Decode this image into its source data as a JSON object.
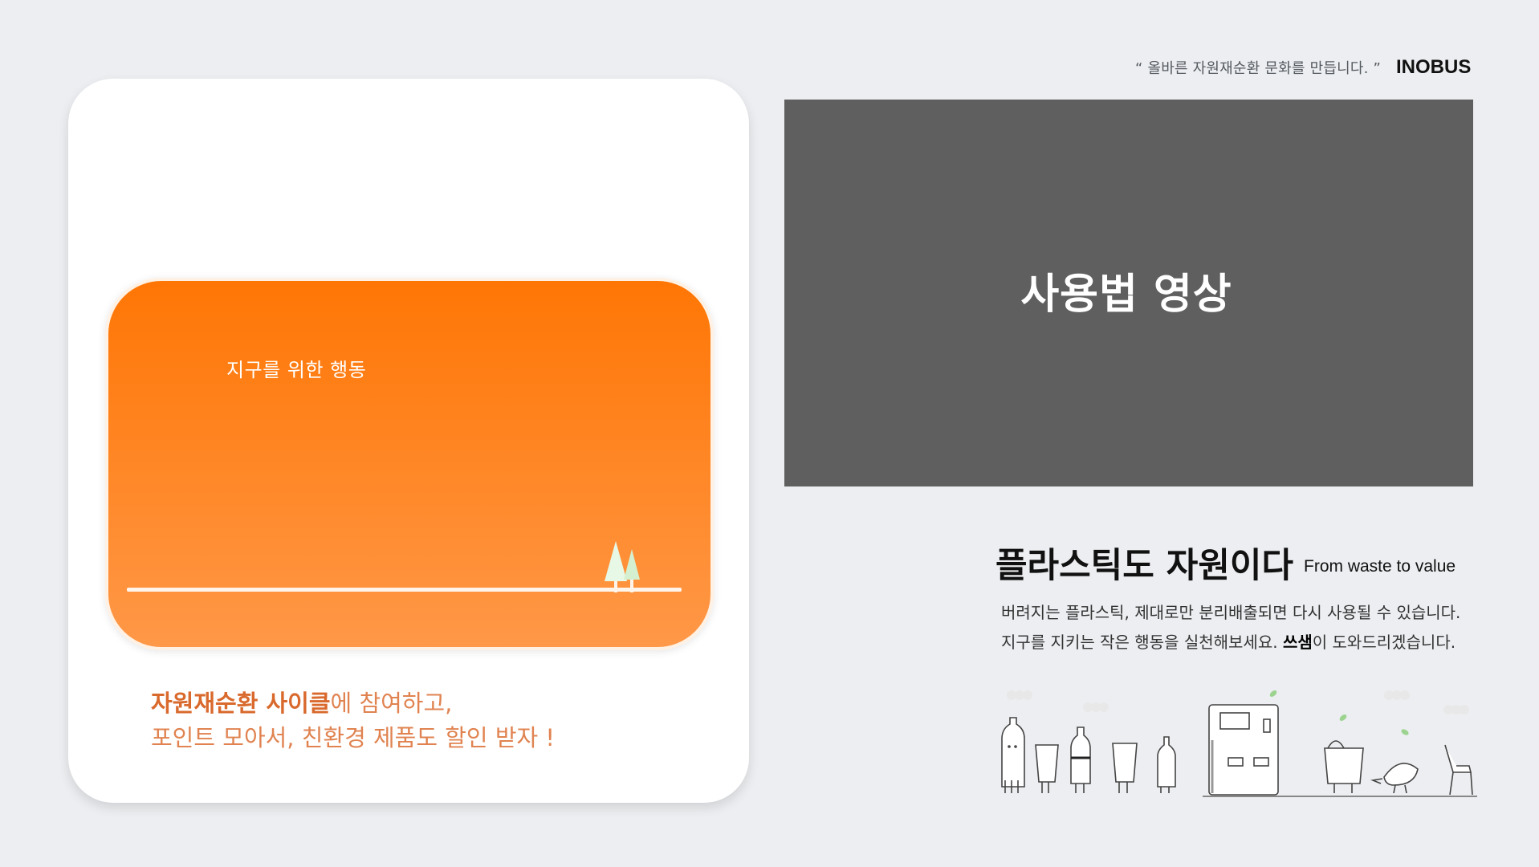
{
  "header": {
    "slogan": "“ 올바른 자원재순환 문화를 만듭니다. ”",
    "brand": "INOBUS"
  },
  "card": {
    "title": "지구를 위한 행동",
    "caption_bold": "자원재순환 사이클",
    "caption_rest": "에 참여하고,",
    "caption_line2": "포인트 모아서, 친환경 제품도 할인 받자 !"
  },
  "video": {
    "label": "사용법 영상"
  },
  "info": {
    "headline": "플라스틱도 자원이다",
    "subheadline": "From waste to value",
    "line1": "버려지는 플라스틱, 제대로만 분리배출되면 다시 사용될 수 있습니다.",
    "line2_pre": "지구를 지키는 작은 행동을 실천해보세요. ",
    "line2_bold": "쓰샘",
    "line2_post": "이 도와드리겠습니다."
  },
  "colors": {
    "accent_orange": "#ff7605",
    "caption_orange": "#d9692c",
    "video_gray": "#5f5f5f",
    "background": "#eceef1"
  },
  "icons": [
    "tree-icon",
    "bottle-icon",
    "cup-icon",
    "vending-machine-icon",
    "bag-icon",
    "bird-icon",
    "chair-icon",
    "leaf-icon"
  ]
}
